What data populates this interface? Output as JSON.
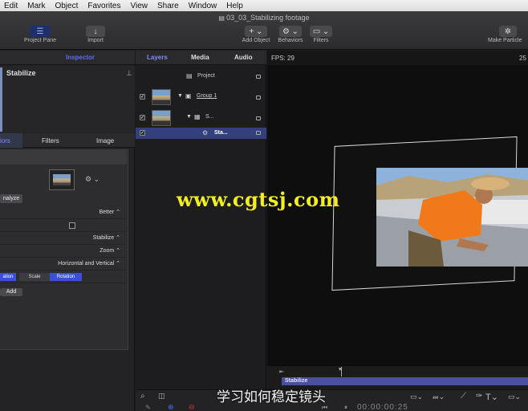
{
  "menu": [
    "Edit",
    "Mark",
    "Object",
    "Favorites",
    "View",
    "Share",
    "Window",
    "Help"
  ],
  "toolbar": {
    "doc_title": "03_03_Stabilizing footage",
    "project_pane": "Project Pane",
    "import": "Import",
    "add_object": "Add Object",
    "behaviors": "Behaviors",
    "filters": "Filters",
    "make_particles": "Make Particle"
  },
  "inspector": {
    "title": "Inspector",
    "name": "Stabilize",
    "tabs": [
      "iors",
      "Filters",
      "Image"
    ],
    "analyze": "nalyze",
    "rows": {
      "method": "Better",
      "borders": "Stabilize",
      "direction": "Zoom",
      "adjust": "Horizontal and Vertical"
    },
    "segments": [
      "ation",
      "Scale",
      "Rotation"
    ],
    "add": "Add"
  },
  "layers": {
    "tabs": [
      "Layers",
      "Media",
      "Audio"
    ],
    "project": "Project",
    "group": "Group 1",
    "clip": "S...",
    "behavior": "Sta..."
  },
  "canvas": {
    "fps": "FPS: 29",
    "zoom": "25"
  },
  "overlay": {
    "watermark": "www.cgtsj.com",
    "subtitle": "学习如何稳定镜头"
  },
  "timeline": {
    "bar_label": "Stabilize",
    "timecode": "00:00:00:25"
  },
  "colors": {
    "accent": "#3d4ed8",
    "watermark": "#f2ee1f"
  }
}
